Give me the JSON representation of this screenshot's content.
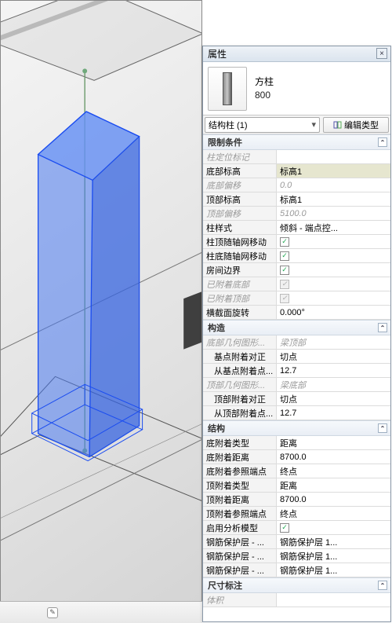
{
  "panel": {
    "title": "属性",
    "close": "×",
    "family": "方柱",
    "type": "800",
    "category": "结构柱 (1)",
    "editType": "编辑类型"
  },
  "groups": {
    "constraints": "限制条件",
    "construction": "构造",
    "structural": "结构",
    "dimensions": "尺寸标注"
  },
  "constraints": [
    {
      "label": "柱定位标记",
      "value": "",
      "ro": true
    },
    {
      "label": "底部标高",
      "value": "标高1",
      "highlight": true
    },
    {
      "label": "底部偏移",
      "value": "0.0",
      "ro": true
    },
    {
      "label": "顶部标高",
      "value": "标高1"
    },
    {
      "label": "顶部偏移",
      "value": "5100.0",
      "ro": true
    },
    {
      "label": "柱样式",
      "value": "倾斜 - 端点控..."
    },
    {
      "label": "柱顶随轴网移动",
      "check": true
    },
    {
      "label": "柱底随轴网移动",
      "check": true
    },
    {
      "label": "房间边界",
      "check": true
    },
    {
      "label": "已附着底部",
      "check": true,
      "ro": true
    },
    {
      "label": "已附着顶部",
      "check": true,
      "ro": true
    },
    {
      "label": "横截面旋转",
      "value": "0.000°"
    }
  ],
  "construction": [
    {
      "label": "底部几何图形...",
      "value": "梁顶部",
      "ro": true
    },
    {
      "label": "基点附着对正",
      "value": "切点",
      "indent": true
    },
    {
      "label": "从基点附着点...",
      "value": "12.7",
      "indent": true
    },
    {
      "label": "顶部几何图形...",
      "value": "梁底部",
      "ro": true
    },
    {
      "label": "顶部附着对正",
      "value": "切点",
      "indent": true
    },
    {
      "label": "从顶部附着点...",
      "value": "12.7",
      "indent": true
    }
  ],
  "structural": [
    {
      "label": "底附着类型",
      "value": "距离"
    },
    {
      "label": "底附着距离",
      "value": "8700.0"
    },
    {
      "label": "底附着参照端点",
      "value": "终点"
    },
    {
      "label": "顶附着类型",
      "value": "距离"
    },
    {
      "label": "顶附着距离",
      "value": "8700.0"
    },
    {
      "label": "顶附着参照端点",
      "value": "终点"
    },
    {
      "label": "启用分析模型",
      "check": true
    },
    {
      "label": "钢筋保护层 - ...",
      "value": "钢筋保护层 1..."
    },
    {
      "label": "钢筋保护层 - ...",
      "value": "钢筋保护层 1..."
    },
    {
      "label": "钢筋保护层 - ...",
      "value": "钢筋保护层 1..."
    }
  ],
  "toggle": "⌃"
}
